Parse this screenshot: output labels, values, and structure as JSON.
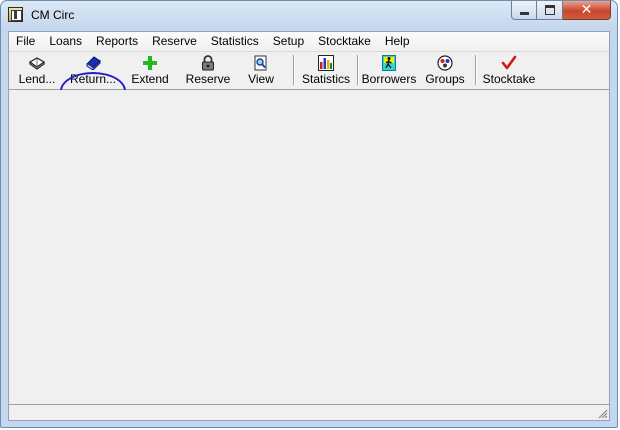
{
  "window": {
    "title": "CM Circ",
    "close_glyph": "✕"
  },
  "menu": [
    {
      "label": "File"
    },
    {
      "label": "Loans"
    },
    {
      "label": "Reports"
    },
    {
      "label": "Reserve"
    },
    {
      "label": "Statistics"
    },
    {
      "label": "Setup"
    },
    {
      "label": "Stocktake"
    },
    {
      "label": "Help"
    }
  ],
  "toolbar": {
    "lend": {
      "label": "Lend...",
      "icon": "open-book-icon"
    },
    "return": {
      "label": "Return...",
      "icon": "closed-book-icon"
    },
    "extend": {
      "label": "Extend",
      "icon": "plus-icon"
    },
    "reserve": {
      "label": "Reserve",
      "icon": "padlock-icon"
    },
    "view": {
      "label": "View",
      "icon": "magnifier-icon"
    },
    "statistics": {
      "label": "Statistics",
      "icon": "bar-chart-icon"
    },
    "borrowers": {
      "label": "Borrowers",
      "icon": "person-walking-icon"
    },
    "groups": {
      "label": "Groups",
      "icon": "people-group-icon"
    },
    "stocktake": {
      "label": "Stocktake",
      "icon": "check-mark-icon"
    }
  },
  "colors": {
    "highlight_ring": "#2323c4",
    "extend_plus": "#22b822",
    "stocktake_check": "#d01818",
    "return_book": "#1a2fb0"
  }
}
